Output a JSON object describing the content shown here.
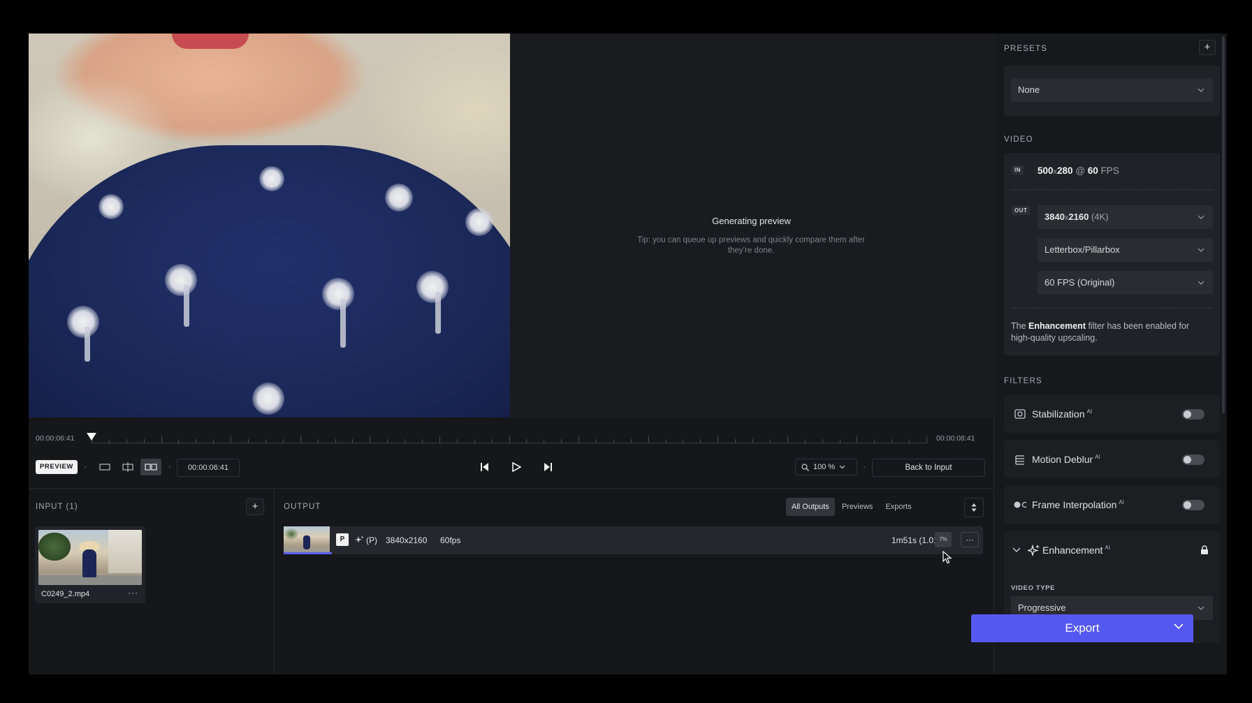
{
  "preview": {
    "generating_title": "Generating preview",
    "generating_tip": "Tip: you can queue up previews and quickly compare them after they’re done."
  },
  "timeline": {
    "current_time": "00:00:06:41",
    "end_time": "00:00:08:41",
    "playhead_progress": 0.028
  },
  "controls": {
    "preview_badge": "PREVIEW",
    "time_display": "00:00:06:41",
    "zoom_value": "100 %",
    "back_to_input": "Back to Input",
    "view_modes": [
      "single-view-icon",
      "split-view-icon",
      "side-by-side-view-icon"
    ],
    "active_view_mode": "side-by-side-view-icon"
  },
  "input_pane": {
    "label": "INPUT (1)",
    "add": "+",
    "file_name": "C0249_2.mp4",
    "more": "···"
  },
  "output_pane": {
    "label": "OUTPUT",
    "tabs": [
      "All Outputs",
      "Previews",
      "Exports"
    ],
    "active_tab": "All Outputs",
    "row": {
      "badge": "P",
      "mode": "(P)",
      "resolution": "3840x2160",
      "fps": "60fps",
      "duration": "1m51s (1.01spf)",
      "percent": "7%",
      "more": "···",
      "progress": 0.07
    }
  },
  "right_panel": {
    "presets": {
      "label": "PRESETS",
      "add": "+",
      "selected": "None"
    },
    "video": {
      "label": "VIDEO",
      "in_tag": "IN",
      "in_w": "500",
      "in_x": "x",
      "in_h": "280",
      "in_at": " @ ",
      "in_fps": "60",
      "in_fps_unit": " FPS",
      "out_tag": "OUT",
      "out_res": "3840",
      "out_x": "x",
      "out_res_h": "2160",
      "out_res_note": " (4K)",
      "crop_mode": "Letterbox/Pillarbox",
      "frame_rate": "60 FPS (Original)",
      "note_pre": "The ",
      "note_bold": "Enhancement",
      "note_post": " filter has been enabled for high-quality upscaling."
    },
    "filters": {
      "label": "FILTERS",
      "items": [
        {
          "name": "Stabilization",
          "ai": "AI",
          "icon": "stabilization-icon",
          "enabled": false
        },
        {
          "name": "Motion Deblur",
          "ai": "AI",
          "icon": "motion-deblur-icon",
          "enabled": false
        },
        {
          "name": "Frame Interpolation",
          "ai": "AI",
          "icon": "frame-interpolation-icon",
          "enabled": false
        }
      ],
      "enhancement": {
        "name": "Enhancement",
        "ai": "AI",
        "video_type_label": "VIDEO TYPE",
        "video_type": "Progressive"
      }
    },
    "export_label": "Export"
  },
  "colors": {
    "accent": "#5558f0",
    "background": "#16171a",
    "panel": "#212227"
  }
}
